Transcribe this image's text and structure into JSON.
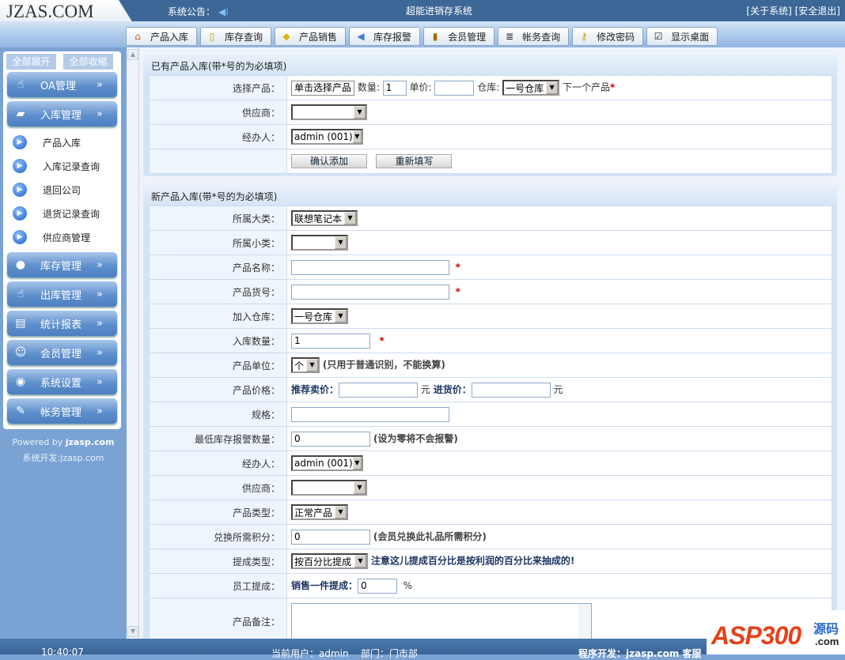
{
  "header": {
    "logo": "JZAS.COM",
    "notice_label": "系统公告：",
    "app_title": "超能进销存系统",
    "about": "[关于系统]",
    "logout": "[安全退出]"
  },
  "toolbar": [
    {
      "label": "产品入库",
      "icon": "house-icon"
    },
    {
      "label": "库存查询",
      "icon": "book-icon"
    },
    {
      "label": "产品销售",
      "icon": "tag-icon"
    },
    {
      "label": "库存报警",
      "icon": "speaker-icon"
    },
    {
      "label": "会员管理",
      "icon": "member-icon"
    },
    {
      "label": "帐务查询",
      "icon": "clipboard-icon"
    },
    {
      "label": "修改密码",
      "icon": "key-icon"
    },
    {
      "label": "显示桌面",
      "icon": "desktop-icon"
    }
  ],
  "sidebar": {
    "expand_all": "全部展开",
    "collapse_all": "全部收缩",
    "menus": [
      "OA管理",
      "入库管理",
      "库存管理",
      "出库管理",
      "统计报表",
      "会员管理",
      "系统设置",
      "帐务管理"
    ],
    "submenu": [
      "产品入库",
      "入库记录查询",
      "退回公司",
      "退货记录查询",
      "供应商管理"
    ],
    "powered": "Powered by ",
    "powered_site": "jzasp.com",
    "dev": "系统开发:jzasp.com"
  },
  "existing": {
    "title": "已有产品入库(带*号的为必填项)",
    "product_label": "选择产品：",
    "product_button": "单击选择产品",
    "qty_label": "数量:",
    "qty": "1",
    "price_label": "单价:",
    "price": "",
    "warehouse_label": "仓库:",
    "warehouse": "一号仓库",
    "next": "下一个产品",
    "star": "*",
    "supplier_label": "供应商：",
    "supplier": "",
    "handler_label": "经办人：",
    "handler": "admin (001)",
    "confirm": "确认添加",
    "reset": "重新填写"
  },
  "newp": {
    "title": "新产品入库(带*号的为必填项)",
    "category_label": "所属大类：",
    "category": "联想笔记本",
    "subcategory_label": "所属小类：",
    "subcategory": "",
    "name_label": "产品名称：",
    "name": "",
    "code_label": "产品货号：",
    "code": "",
    "warehouse_label": "加入仓库：",
    "warehouse": "一号仓库",
    "qty_label": "入库数量：",
    "qty": "1",
    "unit_label": "产品单位：",
    "unit": "个",
    "unit_note": "(只用于普通识别，不能换算)",
    "price_label": "产品价格：",
    "sell_label": "推荐卖价：",
    "sell": "",
    "yuan": "元",
    "buy_label": "进货价：",
    "buy": "",
    "spec_label": "规格：",
    "spec": "",
    "minstock_label": "最低库存报警数量：",
    "minstock": "0",
    "minstock_note": "(设为零将不会报警)",
    "handler_label": "经办人：",
    "handler": "admin (001)",
    "supplier_label": "供应商：",
    "supplier": "",
    "type_label": "产品类型：",
    "type": "正常产品",
    "points_label": "兑换所需积分：",
    "points": "0",
    "points_note": "(会员兑换此礼品所需积分)",
    "commtype_label": "提成类型：",
    "commtype": "按百分比提成",
    "commtype_note": "注意这儿提成百分比是按利润的百分比来抽成的!",
    "staff_label": "员工提成：",
    "staff_sub": "销售一件提成：",
    "staff": "0",
    "percent": "%",
    "remark_label": "产品备注：",
    "remark": "",
    "star": "*"
  },
  "footer": {
    "time": "10:40:07",
    "user": "当前用户：admin    部门：门市部",
    "dev": "程序开发：jzasp.com 客服"
  },
  "watermark": {
    "text": "ASP300",
    "sub": "源码",
    ".com": ".com"
  }
}
